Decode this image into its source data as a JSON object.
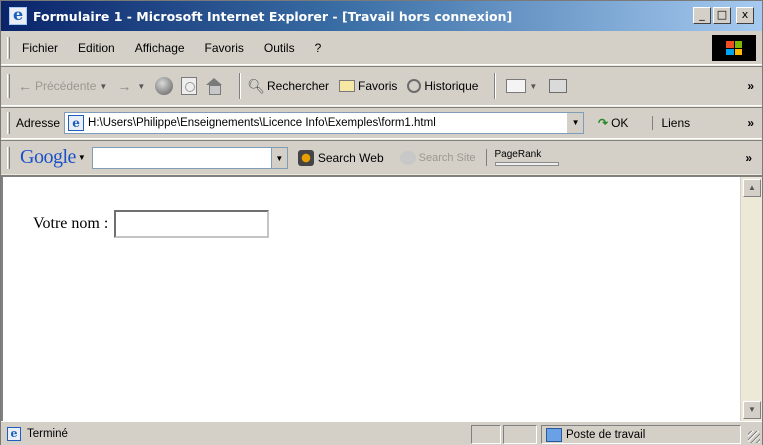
{
  "window": {
    "title": "Formulaire 1 - Microsoft Internet Explorer - [Travail hors connexion]",
    "controls": {
      "minimize": "_",
      "maximize": "□",
      "close": "x"
    }
  },
  "menu": {
    "items": [
      "Fichier",
      "Edition",
      "Affichage",
      "Favoris",
      "Outils",
      "?"
    ]
  },
  "toolbar": {
    "back_label": "Précédente",
    "search_label": "Rechercher",
    "favorites_label": "Favoris",
    "history_label": "Historique"
  },
  "address": {
    "label": "Adresse",
    "value": "H:\\Users\\Philippe\\Enseignements\\Licence Info\\Exemples\\form1.html",
    "go_label": "OK",
    "links_label": "Liens"
  },
  "google": {
    "logo": "Google",
    "search_value": "",
    "search_web_label": "Search Web",
    "search_site_label": "Search Site",
    "pagerank_label": "PageRank"
  },
  "page": {
    "field_label": "Votre nom :",
    "field_value": ""
  },
  "status": {
    "text": "Terminé",
    "zone": "Poste de travail"
  }
}
